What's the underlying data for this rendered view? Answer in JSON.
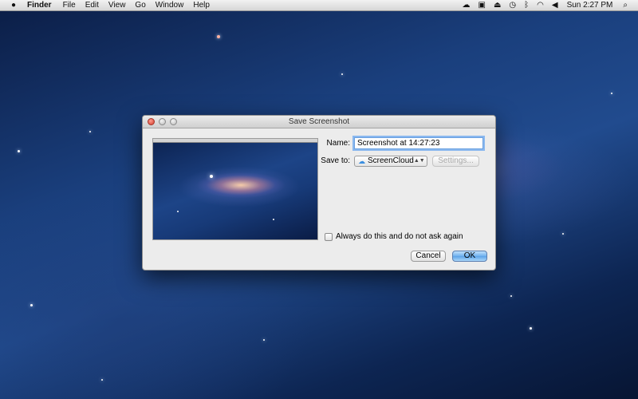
{
  "menubar": {
    "apple_icon": "apple-icon",
    "app_name": "Finder",
    "items": [
      "File",
      "Edit",
      "View",
      "Go",
      "Window",
      "Help"
    ],
    "status_icons": [
      "screencloud-icon",
      "a-box-icon",
      "eject-icon",
      "time-machine-icon",
      "bluetooth-icon",
      "wifi-icon",
      "volume-icon"
    ],
    "clock": "Sun 2:27 PM"
  },
  "dialog": {
    "title": "Save Screenshot",
    "name_label": "Name:",
    "name_value": "Screenshot at 14:27:23",
    "save_to_label": "Save to:",
    "save_to_value": "ScreenCloud",
    "settings_label": "Settings...",
    "always_label": "Always do this and do not ask again",
    "cancel_label": "Cancel",
    "ok_label": "OK"
  },
  "colors": {
    "accent": "#5ca3e8",
    "close_button": "#d33c2c",
    "desktop": "#1a3f7d"
  }
}
